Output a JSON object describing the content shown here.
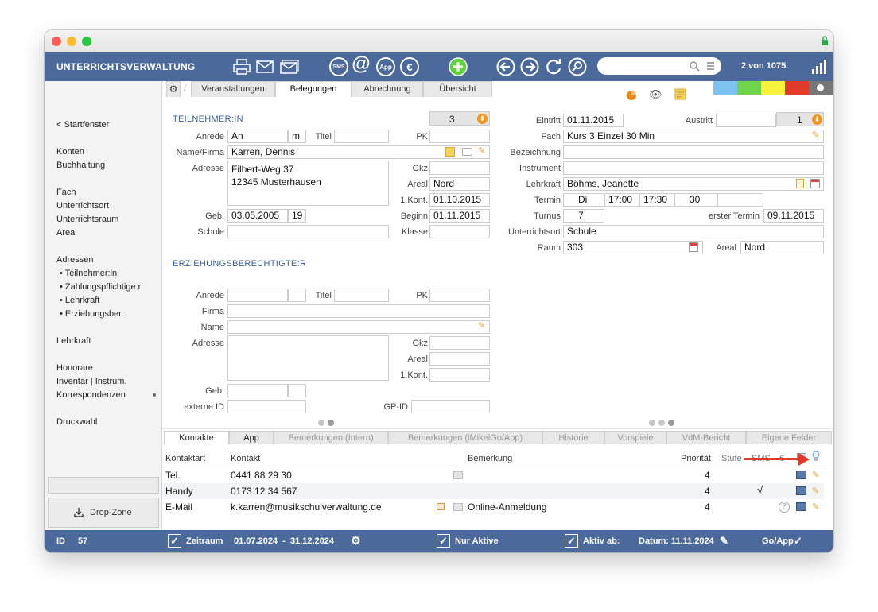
{
  "app": {
    "title": "UNTERRICHTSVERWALTUNG",
    "record_counter": "2 von 1075"
  },
  "toolbar": {
    "sms": "SMS",
    "at": "@",
    "app": "App",
    "euro": "€",
    "plus": "+"
  },
  "sidebar": {
    "back": "< Startfenster",
    "items": [
      "Konten",
      "Buchhaltung",
      "Fach",
      "Unterrichtsort",
      "Unterrichtsraum",
      "Areal",
      "Adressen",
      "• Teilnehmer:in",
      "• Zahlungspflichtige:r",
      "• Lehrkraft",
      "• Erziehungsber.",
      "Lehrkraft",
      "Honorare",
      "Inventar | Instrum.",
      "Korrespondenzen",
      "Druckwahl"
    ],
    "dropzone": "Drop-Zone"
  },
  "tabs": [
    "Veranstaltungen",
    "Belegungen",
    "Abrechnung",
    "Übersicht"
  ],
  "colors": {
    "accent": "#4b6a9b",
    "swatches": [
      "#7ec4f2",
      "#6fd44a",
      "#f7f23c",
      "#e03a2a",
      "#777777"
    ]
  },
  "participant": {
    "section_title": "TEILNEHMER:IN",
    "count": "3",
    "labels": {
      "anrede": "Anrede",
      "titel": "Titel",
      "pk": "PK",
      "name": "Name/Firma",
      "adresse": "Adresse",
      "gkz": "Gkz",
      "areal": "Areal",
      "kont": "1.Kont.",
      "geb": "Geb.",
      "beginn": "Beginn",
      "schule": "Schule",
      "klasse": "Klasse"
    },
    "anrede": "An",
    "anrede2": "m",
    "name": "Karren, Dennis",
    "address_line1": "Filbert-Weg 37",
    "address_line2": "12345 Musterhausen",
    "areal": "Nord",
    "kont": "01.10.2015",
    "geb": "03.05.2005",
    "age": "19",
    "beginn": "01.11.2015"
  },
  "course": {
    "labels": {
      "eintritt": "Eintritt",
      "austritt": "Austritt",
      "fach": "Fach",
      "bezeichnung": "Bezeichnung",
      "instrument": "Instrument",
      "lehrkraft": "Lehrkraft",
      "termin": "Termin",
      "turnus": "Turnus",
      "erster": "erster Termin",
      "ort": "Unterrichtsort",
      "raum": "Raum",
      "areal": "Areal"
    },
    "eintritt": "01.11.2015",
    "austritt_count": "1",
    "fach": "Kurs 3 Einzel 30 Min",
    "lehrkraft": "Böhms, Jeanette",
    "termin_day": "Di",
    "termin_from": "17:00",
    "termin_to": "17:30",
    "termin_min": "30",
    "turnus": "7",
    "erster_termin": "09.11.2015",
    "ort": "Schule",
    "raum": "303",
    "areal": "Nord"
  },
  "guardian": {
    "section_title": "ERZIEHUNGSBERECHTIGTE:R",
    "labels": {
      "anrede": "Anrede",
      "titel": "Titel",
      "pk": "PK",
      "firma": "Firma",
      "name": "Name",
      "adresse": "Adresse",
      "gkz": "Gkz",
      "areal": "Areal",
      "kont": "1.Kont.",
      "geb": "Geb.",
      "extid": "externe ID",
      "gpid": "GP-ID"
    }
  },
  "bottom_tabs": [
    "Kontakte",
    "App",
    "Bemerkungen (Intern)",
    "Bemerkungen (iMikelGo/App)",
    "Historie",
    "Vorspiele",
    "VdM-Bericht",
    "Eigene Felder"
  ],
  "contacts": {
    "headers": {
      "art": "Kontaktart",
      "kontakt": "Kontakt",
      "bemerkung": "Bemerkung",
      "prio": "Priorität",
      "stufe": "Stufe",
      "sms": "SMS",
      "euro": "€"
    },
    "rows": [
      {
        "art": "Tel.",
        "kontakt": "0441 88 29 30",
        "bemerkung": "",
        "prio": "4",
        "sms": ""
      },
      {
        "art": "Handy",
        "kontakt": "0173 12 34 567",
        "bemerkung": "",
        "prio": "4",
        "sms": "√"
      },
      {
        "art": "E-Mail",
        "kontakt": "k.karren@musikschulverwaltung.de",
        "bemerkung": "Online-Anmeldung",
        "prio": "4",
        "sms": ""
      }
    ]
  },
  "status": {
    "id_label": "ID",
    "id_value": "57",
    "zeitraum_label": "Zeitraum",
    "zeitraum_value": "01.07.2024  -  31.12.2024",
    "nur_aktive": "Nur Aktive",
    "aktiv_ab": "Aktiv ab:",
    "datum": "Datum: 11.11.2024",
    "go_app": "Go/App"
  }
}
